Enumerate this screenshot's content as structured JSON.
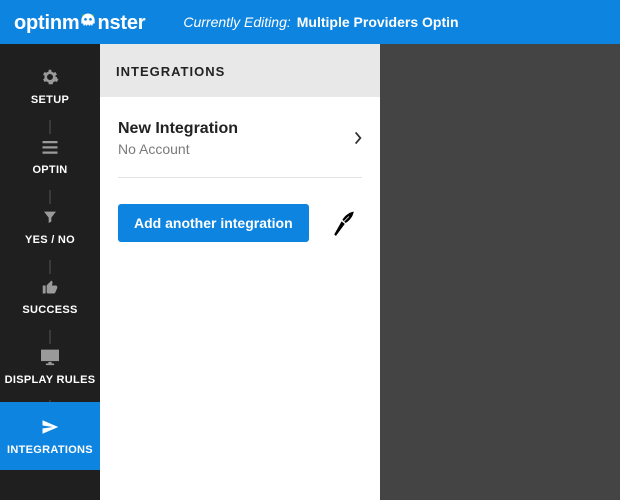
{
  "brand": {
    "pre": "optinm",
    "post": "nster"
  },
  "header": {
    "editing_label": "Currently Editing:",
    "editing_name": "Multiple Providers Optin"
  },
  "sidebar": {
    "items": [
      {
        "label": "SETUP",
        "icon": "gear"
      },
      {
        "label": "OPTIN",
        "icon": "menu"
      },
      {
        "label": "YES / NO",
        "icon": "funnel"
      },
      {
        "label": "SUCCESS",
        "icon": "thumbs-up"
      },
      {
        "label": "DISPLAY RULES",
        "icon": "monitor"
      },
      {
        "label": "INTEGRATIONS",
        "icon": "send",
        "active": true
      }
    ]
  },
  "panel": {
    "title": "INTEGRATIONS",
    "integration_row": {
      "title": "New Integration",
      "subtitle": "No Account"
    },
    "add_button": "Add another integration"
  },
  "colors": {
    "brand_blue": "#0d84e0",
    "sidebar_bg": "#1f1f1f",
    "canvas_bg": "#444444"
  }
}
